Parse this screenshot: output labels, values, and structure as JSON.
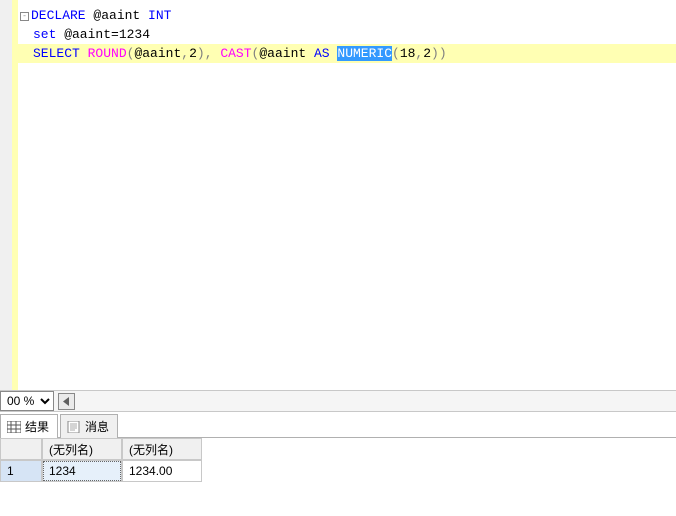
{
  "editor": {
    "line1": {
      "declare": "DECLARE",
      "var": " @aaint ",
      "int": "INT"
    },
    "line2": {
      "set": "set",
      "rest": " @aaint=1234"
    },
    "line3": {
      "select": "SELECT",
      "round": "ROUND",
      "p1": "(",
      "var": "@aaint",
      "comma1": ",",
      "two": "2",
      "p2": ")",
      "comma2": ",",
      "cast": "CAST",
      "p3": "(",
      "var2": "@aaint ",
      "as": "AS",
      "sp": " ",
      "numeric": "NUMERIC",
      "p4": "(",
      "n18": "18",
      "comma3": ",",
      "n2": "2",
      "p5": ")",
      "p6": ")"
    }
  },
  "zoom": {
    "value": "00 %"
  },
  "tabs": {
    "results": "结果",
    "messages": "消息"
  },
  "grid": {
    "col1": "(无列名)",
    "col2": "(无列名)",
    "row1": "1",
    "val1": "1234",
    "val2": "1234.00"
  }
}
